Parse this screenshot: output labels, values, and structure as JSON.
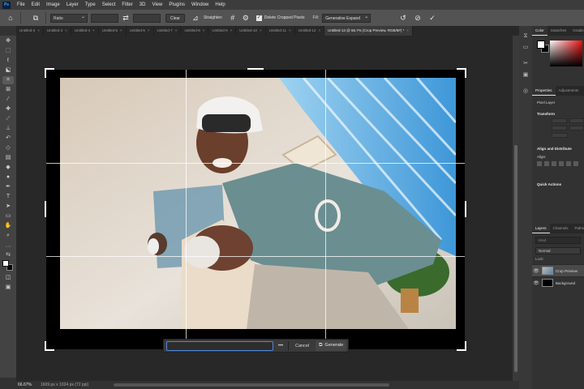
{
  "app": {
    "logo_text": "Ps",
    "menu": [
      "File",
      "Edit",
      "Image",
      "Layer",
      "Type",
      "Select",
      "Filter",
      "3D",
      "View",
      "Plugins",
      "Window",
      "Help"
    ]
  },
  "options_bar": {
    "ratio_label": "Ratio",
    "clear_label": "Clear",
    "straighten_label": "Straighten",
    "delete_cropped_label": "Delete Cropped Pixels",
    "fill_label": "Fill:",
    "fill_value": "Generative Expand"
  },
  "tabs": [
    {
      "label": "Untitled-2",
      "close": "×"
    },
    {
      "label": "Untitled-3",
      "close": "×"
    },
    {
      "label": "Untitled-4",
      "close": "×"
    },
    {
      "label": "Untitled-5",
      "close": "×"
    },
    {
      "label": "Untitled-6",
      "close": "×"
    },
    {
      "label": "Untitled-7",
      "close": "×"
    },
    {
      "label": "Untitled-8",
      "close": "×"
    },
    {
      "label": "Untitled-9",
      "close": "×"
    },
    {
      "label": "Untitled-10",
      "close": "×"
    },
    {
      "label": "Untitled-11",
      "close": "×"
    },
    {
      "label": "Untitled-12",
      "close": "×"
    },
    {
      "label": "Untitled-13 @ 66.7% (Crop Preview, RGB/8#) *",
      "close": "×",
      "active": true
    }
  ],
  "generate_bar": {
    "more_label": "•••",
    "cancel_label": "Cancel",
    "generate_label": "Generate"
  },
  "status": {
    "zoom": "66.67%",
    "dimensions": "1609 px x 1024 px (72 ppi)"
  },
  "right_panels": {
    "color_tabs": [
      "Color",
      "Swatches",
      "Gradient"
    ],
    "props_tabs": [
      "Properties",
      "Adjustments"
    ],
    "pixel_layer_label": "Pixel Layer",
    "transform_label": "Transform",
    "align_label": "Align and Distribute",
    "align_sub": "Align:",
    "quick_actions_label": "Quick Actions",
    "layers_tabs": [
      "Layers",
      "Channels",
      "Paths"
    ],
    "search_placeholder": "Kind",
    "blend_mode": "Normal",
    "lock_label": "Lock:",
    "layers": [
      {
        "name": "Crop Preview",
        "selected": true
      },
      {
        "name": "Background",
        "selected": false
      }
    ]
  }
}
